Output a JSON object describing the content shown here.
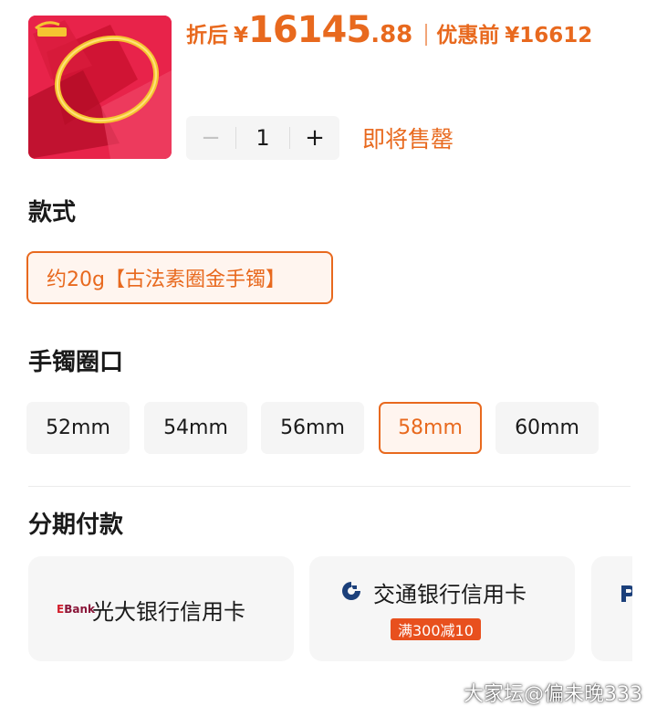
{
  "product": {
    "thumbnail_icon": "gold-bangle-on-red-envelopes-image",
    "price_prefix": "折后",
    "currency_symbol": "¥",
    "price_integer": "16145",
    "price_decimal": ".88",
    "original_label": "优惠前",
    "original_price": "¥16612",
    "quantity": "1",
    "minus_icon": "−",
    "plus_icon": "+",
    "stock_status": "即将售罄"
  },
  "style_section": {
    "title": "款式",
    "options": [
      {
        "label": "约20g【古法素圈金手镯】",
        "selected": true
      }
    ]
  },
  "size_section": {
    "title": "手镯圈口",
    "options": [
      {
        "label": "52mm",
        "selected": false
      },
      {
        "label": "54mm",
        "selected": false
      },
      {
        "label": "56mm",
        "selected": false
      },
      {
        "label": "58mm",
        "selected": true
      },
      {
        "label": "60mm",
        "selected": false
      }
    ]
  },
  "installment_section": {
    "title": "分期付款",
    "banks": [
      {
        "name": "光大银行信用卡",
        "logo_text": "Bank",
        "icon": "ceb-bank-logo-icon"
      },
      {
        "name": "交通银行信用卡",
        "promo": "满300减10",
        "icon": "bocom-bank-logo-icon"
      },
      {
        "name": "",
        "icon": "partial-bank-logo-icon"
      }
    ]
  },
  "watermark": "大家坛@偏未晚333",
  "colors": {
    "accent": "#e8691e",
    "accent_bg": "#fff5ef",
    "chip_bg": "#f5f5f5",
    "promo_bg": "#e8501e",
    "thumb_bg": "#e8234a"
  }
}
